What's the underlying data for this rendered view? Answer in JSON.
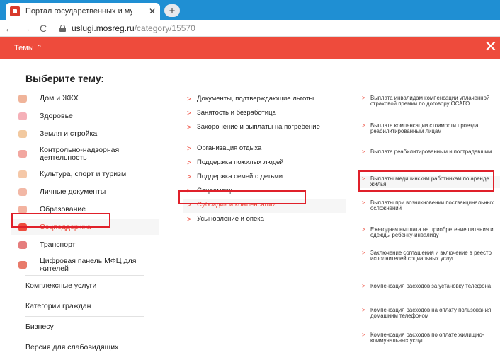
{
  "browser": {
    "tab_title": "Портал государственных и муни",
    "tab_close": "✕",
    "new_tab": "+",
    "nav_back": "←",
    "nav_forward": "→",
    "nav_reload": "C",
    "url_host": "uslugi.mosreg.ru",
    "url_path": "/category/15570"
  },
  "header": {
    "topics_label": "Темы ⌃",
    "close": "✕"
  },
  "panel": {
    "heading": "Выберите тему:",
    "categories": [
      {
        "label": "Дом и ЖКХ",
        "color": "#f0b49a"
      },
      {
        "label": "Здоровье",
        "color": "#f5b0b8"
      },
      {
        "label": "Земля и стройка",
        "color": "#f2c9a0"
      },
      {
        "label": "Контрольно-надзорная деятельность",
        "color": "#f2a7a0"
      },
      {
        "label": "Культура, спорт и туризм",
        "color": "#f5c8a8"
      },
      {
        "label": "Личные документы",
        "color": "#f2b8a6"
      },
      {
        "label": "Образование",
        "color": "#f3b3a0"
      },
      {
        "label": "Соцподдержка",
        "color": "#ee4b3c"
      },
      {
        "label": "Транспорт",
        "color": "#e57d7d"
      },
      {
        "label": "Цифровая панель МФЦ для жителей",
        "color": "#e87a6a"
      }
    ],
    "bottom_links": [
      "Комплексные услуги",
      "Категории граждан",
      "Бизнесу",
      "Версия для слабовидящих"
    ],
    "subcategories": [
      "Документы, подтверждающие льготы",
      "Занятость и безработица",
      "Захоронение и выплаты на погребение",
      "Организация отдыха",
      "Поддержка пожилых людей",
      "Поддержка семей с детьми",
      "Соцпомощь",
      "Субсидии и компенсации",
      "Усыновление и опека"
    ],
    "services": [
      "Выплата инвалидам компенсации уплаченной страховой премии по договору ОСАГО",
      "Выплата компенсации стоимости проезда реабилитированным лицам",
      "Выплата реабилитированным и пострадавшим",
      "Выплаты медицинским работникам по аренде жилья",
      "Выплаты при возникновении поствакцинальных осложнений",
      "Ежегодная выплата на приобретение питания и одежды ребенку-инвалиду",
      "Заключение соглашения и включение в реестр исполнителей социальных услуг",
      "Компенсация расходов за установку телефона",
      "Компенсация расходов на оплату пользования домашним телефоном",
      "Компенсация расходов по оплате жилищно-коммунальных услуг"
    ],
    "chevron": ">"
  },
  "colors": {
    "accent": "#ee4b3c",
    "highlight": "#e0202a",
    "chrome": "#1f8fd3"
  }
}
